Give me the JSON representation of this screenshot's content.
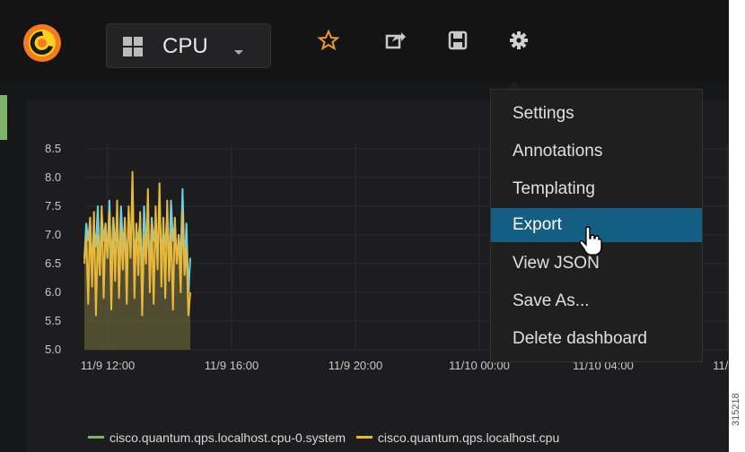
{
  "topbar": {
    "dashboard_title": "CPU",
    "icons": [
      "grafana-logo-icon",
      "dashboard-grid-icon",
      "star-icon",
      "share-icon",
      "save-icon",
      "gear-icon"
    ]
  },
  "menu": {
    "items": [
      {
        "label": "Settings"
      },
      {
        "label": "Annotations"
      },
      {
        "label": "Templating"
      },
      {
        "label": "Export"
      },
      {
        "label": "View JSON"
      },
      {
        "label": "Save As..."
      },
      {
        "label": "Delete dashboard"
      }
    ],
    "active_index": 3
  },
  "legend": {
    "items": [
      {
        "label": "cisco.quantum.qps.localhost.cpu-0.system",
        "color": "#7eb26d"
      },
      {
        "label": "cisco.quantum.qps.localhost.cpu",
        "color": "#eab839"
      }
    ]
  },
  "side_label": "315218",
  "chart_data": {
    "type": "area",
    "y_ticks": [
      "8.5",
      "8.0",
      "7.5",
      "7.0",
      "6.5",
      "6.0",
      "5.5",
      "5.0"
    ],
    "x_ticks": [
      "11/9 12:00",
      "11/9 16:00",
      "11/9 20:00",
      "11/10 00:00",
      "11/10 04:00",
      "11/10"
    ],
    "ylim": [
      5.0,
      8.5
    ],
    "grid": true,
    "series": [
      {
        "color": "#6ed0e0",
        "values": [
          6.6,
          7.2,
          6.9,
          7.3,
          6.4,
          7.1,
          6.8,
          7.5,
          6.3,
          7.4,
          6.9,
          7.2,
          6.6,
          7.6,
          6.4,
          7.3,
          6.9,
          7.1,
          6.5,
          7.5,
          6.8,
          7.2,
          6.4,
          7.4,
          6.7,
          7.8,
          6.5,
          7.1,
          6.9,
          7.3,
          6.2,
          7.5,
          6.8,
          7.0,
          6.4,
          7.3,
          6.9,
          7.2,
          6.5,
          7.7,
          6.6,
          7.1,
          6.8,
          7.4,
          6.3,
          7.6,
          6.9,
          7.2,
          6.5,
          7.0,
          6.6,
          7.8,
          6.4,
          7.2,
          6.0,
          6.6
        ]
      },
      {
        "color": "#eab839",
        "values": [
          6.5,
          7.0,
          5.8,
          7.3,
          6.1,
          7.4,
          5.6,
          7.0,
          6.3,
          7.5,
          5.9,
          7.2,
          6.6,
          7.4,
          5.7,
          7.3,
          6.2,
          7.6,
          5.9,
          7.1,
          6.4,
          7.3,
          5.8,
          7.5,
          6.6,
          8.1,
          5.9,
          7.2,
          6.3,
          7.4,
          5.6,
          7.0,
          6.5,
          7.8,
          6.0,
          7.2,
          5.8,
          7.5,
          6.4,
          7.9,
          6.1,
          7.3,
          5.9,
          7.6,
          6.2,
          7.1,
          5.7,
          7.3,
          6.5,
          7.0,
          6.0,
          7.4,
          6.3,
          6.8,
          5.6,
          6.0
        ]
      }
    ]
  }
}
